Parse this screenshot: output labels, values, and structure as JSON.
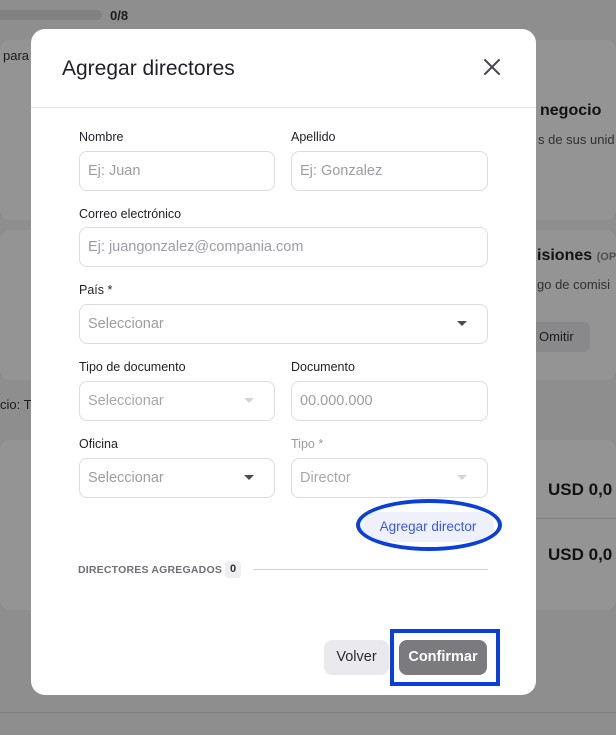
{
  "background": {
    "progress_text": "0/8",
    "left_snippet_1": "para",
    "left_snippet_2": "cio: T",
    "right_heading_1": "negocio",
    "right_sub_1": "s de sus unid",
    "right_heading_2": "isiones",
    "right_heading_2_tag": "(OP",
    "right_sub_2": "go de comisi",
    "omit_label": "Omitir",
    "amount_1": "USD 0,0",
    "amount_2": "USD 0,0"
  },
  "modal": {
    "title": "Agregar directores",
    "close_icon": "close-icon",
    "fields": {
      "nombre": {
        "label": "Nombre",
        "placeholder": "Ej: Juan"
      },
      "apellido": {
        "label": "Apellido",
        "placeholder": "Ej: Gonzalez"
      },
      "correo": {
        "label": "Correo electrónico",
        "placeholder": "Ej: juangonzalez@compania.com"
      },
      "pais": {
        "label": "País *",
        "placeholder": "Seleccionar"
      },
      "tipo_documento": {
        "label": "Tipo de documento",
        "placeholder": "Seleccionar"
      },
      "documento": {
        "label": "Documento",
        "placeholder": "00.000.000"
      },
      "oficina": {
        "label": "Oficina",
        "placeholder": "Seleccionar"
      },
      "tipo": {
        "label": "Tipo *",
        "value": "Director"
      }
    },
    "add_button": "Agregar director",
    "added_section": {
      "label": "DIRECTORES AGREGADOS",
      "count": "0"
    },
    "back_button": "Volver",
    "confirm_button": "Confirmar"
  },
  "colors": {
    "accent": "#3b5bd9",
    "highlight": "#0a3fd9",
    "confirm_bg": "#7b7b7f"
  }
}
